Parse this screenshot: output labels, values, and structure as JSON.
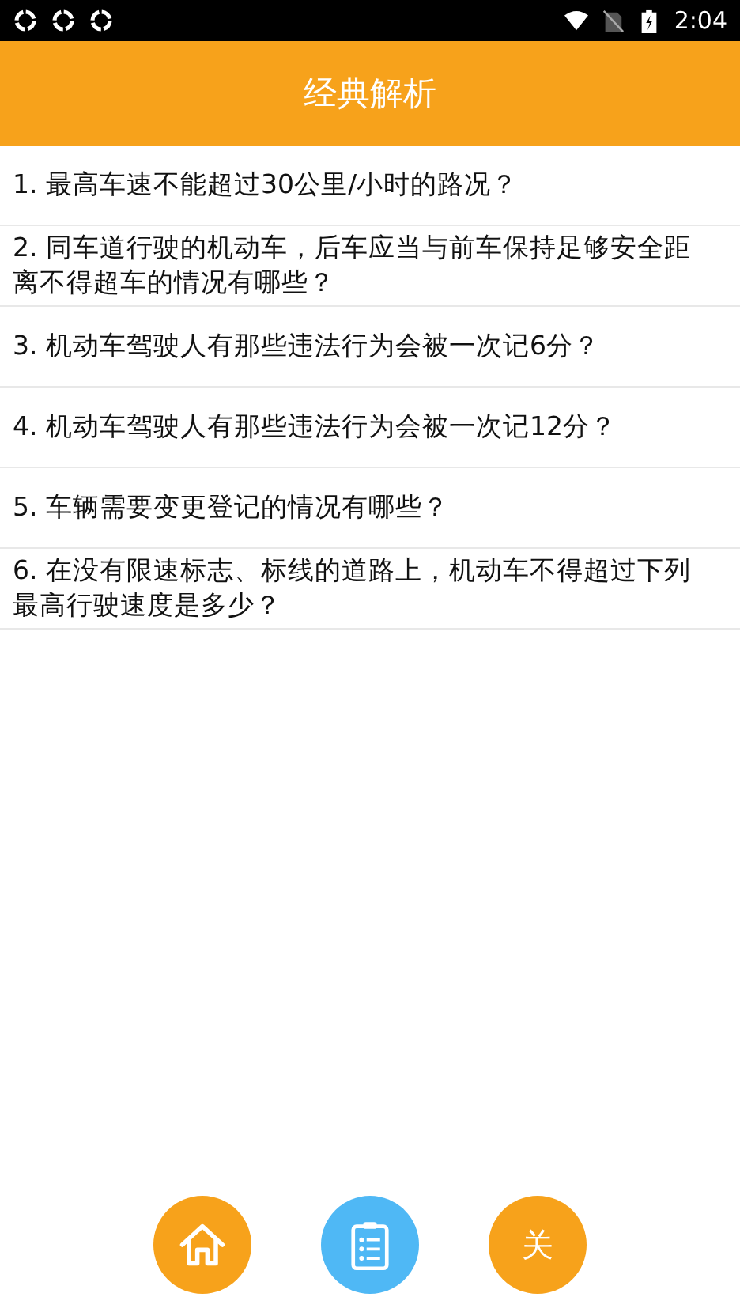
{
  "status_bar": {
    "time": "2:04",
    "notifications": [
      {
        "kind": "sync"
      },
      {
        "kind": "sync"
      },
      {
        "kind": "sync"
      }
    ]
  },
  "header": {
    "title": "经典解析"
  },
  "questions": [
    {
      "text": "1. 最高车速不能超过30公里/小时的路况？"
    },
    {
      "text": "2. 同车道行驶的机动车，后车应当与前车保持足够安全距离不得超车的情况有哪些？"
    },
    {
      "text": "3. 机动车驾驶人有那些违法行为会被一次记6分？"
    },
    {
      "text": "4. 机动车驾驶人有那些违法行为会被一次记12分？"
    },
    {
      "text": "5. 车辆需要变更登记的情况有哪些？"
    },
    {
      "text": "6. 在没有限速标志、标线的道路上，机动车不得超过下列最高行驶速度是多少？"
    }
  ],
  "bottom_buttons": [
    {
      "kind": "home",
      "color": "#f7a21b"
    },
    {
      "kind": "list",
      "color": "#4fb8f5"
    },
    {
      "kind": "text",
      "color": "#f7a21b",
      "label": "关"
    }
  ]
}
